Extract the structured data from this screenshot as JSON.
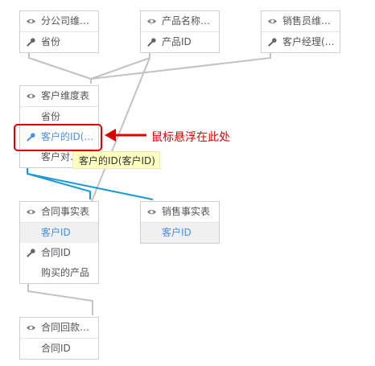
{
  "tables": {
    "fenGongSi": {
      "title": "分公司维…",
      "rows": [
        "省份"
      ]
    },
    "chanPinMingCheng": {
      "title": "产品名称…",
      "rows": [
        "产品ID"
      ]
    },
    "xiaoShouYuanWei": {
      "title": "销售员维…",
      "rows": [
        "客户经理(…"
      ]
    },
    "keHuWeiDu": {
      "title": "客户维度表",
      "rows": [
        "省份",
        "客户的ID(…",
        "客户对…"
      ]
    },
    "heTongShiShi": {
      "title": "合同事实表",
      "rows": [
        "客户ID",
        "合同ID",
        "购买的产品"
      ]
    },
    "xiaoShouShiShi": {
      "title": "销售事实表",
      "rows": [
        "客户ID"
      ]
    },
    "heTongHuiKuan": {
      "title": "合同回款…",
      "rows": [
        "合同ID"
      ]
    }
  },
  "tooltip": "客户的ID(客户ID)",
  "annotation": "鼠标悬浮在此处",
  "colors": {
    "accent": "#4a90e2",
    "highlight": "#e00000",
    "link_line": "#1a9ad6",
    "neutral_line": "#c2c2c2"
  },
  "icons": {
    "header": "eye-icon",
    "key": "key-icon"
  }
}
